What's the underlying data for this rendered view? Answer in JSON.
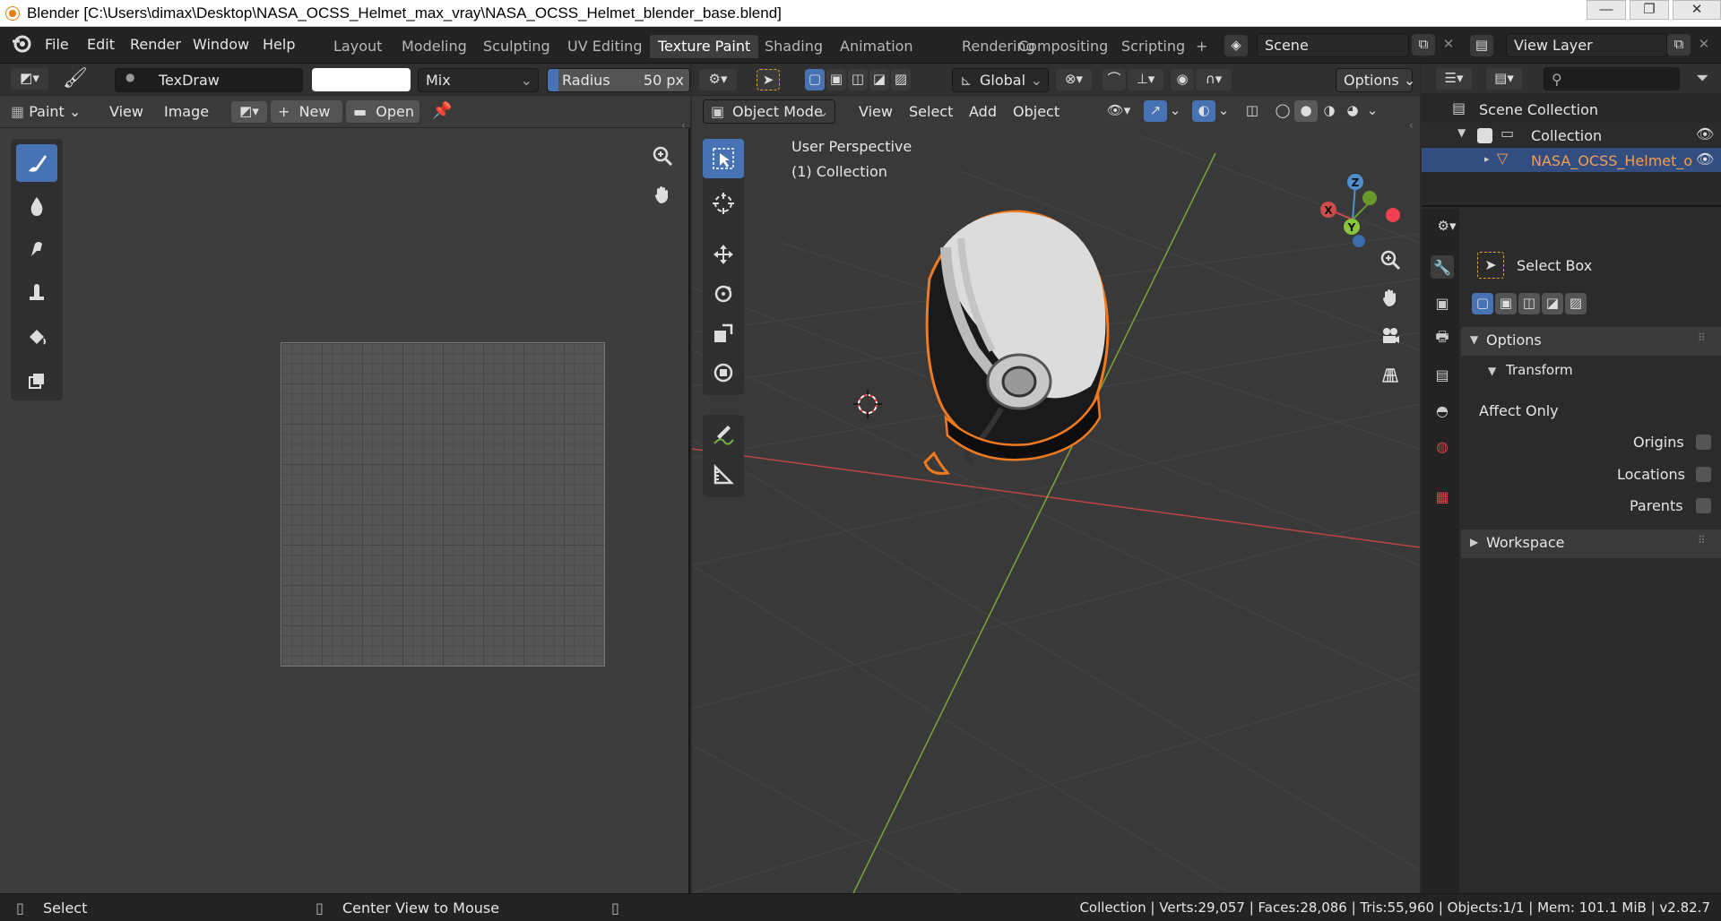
{
  "window": {
    "title": "Blender [C:\\Users\\dimax\\Desktop\\NASA_OCSS_Helmet_max_vray\\NASA_OCSS_Helmet_blender_base.blend]",
    "min_glyph": "—",
    "max_glyph": "❐",
    "close_glyph": "✕"
  },
  "menubar": {
    "items": [
      "File",
      "Edit",
      "Render",
      "Window",
      "Help"
    ],
    "workspaces": [
      "Layout",
      "Modeling",
      "Sculpting",
      "UV Editing",
      "Texture Paint",
      "Shading",
      "Animation",
      "Rendering",
      "Compositing",
      "Scripting"
    ],
    "active_workspace": "Texture Paint",
    "add_workspace": "+",
    "scene": "Scene",
    "view_layer": "View Layer"
  },
  "image_editor": {
    "brush_name": "TexDraw",
    "blend_mode": "Mix",
    "radius_label": "Radius",
    "radius_value": "50 px",
    "mode": "Paint",
    "menu_view": "View",
    "menu_image": "Image",
    "new_label": "New",
    "open_label": "Open",
    "brush_color": "#ffffff"
  },
  "viewport": {
    "transform_orientation": "Global",
    "options_label": "Options",
    "mode": "Object Mode",
    "menus": [
      "View",
      "Select",
      "Add",
      "Object"
    ],
    "perspective_label": "User Perspective",
    "collection_label": "(1) Collection",
    "axis_x": "X",
    "axis_y": "Y",
    "axis_z": "Z"
  },
  "outliner": {
    "scene_collection": "Scene Collection",
    "collection": "Collection",
    "object": "NASA_OCSS_Helmet_obj",
    "object_color": "#f0a050"
  },
  "properties": {
    "active_tool": "Select Box",
    "options_label": "Options",
    "transform_label": "Transform",
    "affect_only_label": "Affect Only",
    "checkboxes": [
      "Origins",
      "Locations",
      "Parents"
    ],
    "workspace_label": "Workspace"
  },
  "statusbar": {
    "left_action": "Select",
    "middle_action": "Center View to Mouse",
    "stats": "Collection | Verts:29,057 | Faces:28,086 | Tris:55,960 | Objects:1/1 | Mem: 101.1 MiB | v2.82.7"
  }
}
